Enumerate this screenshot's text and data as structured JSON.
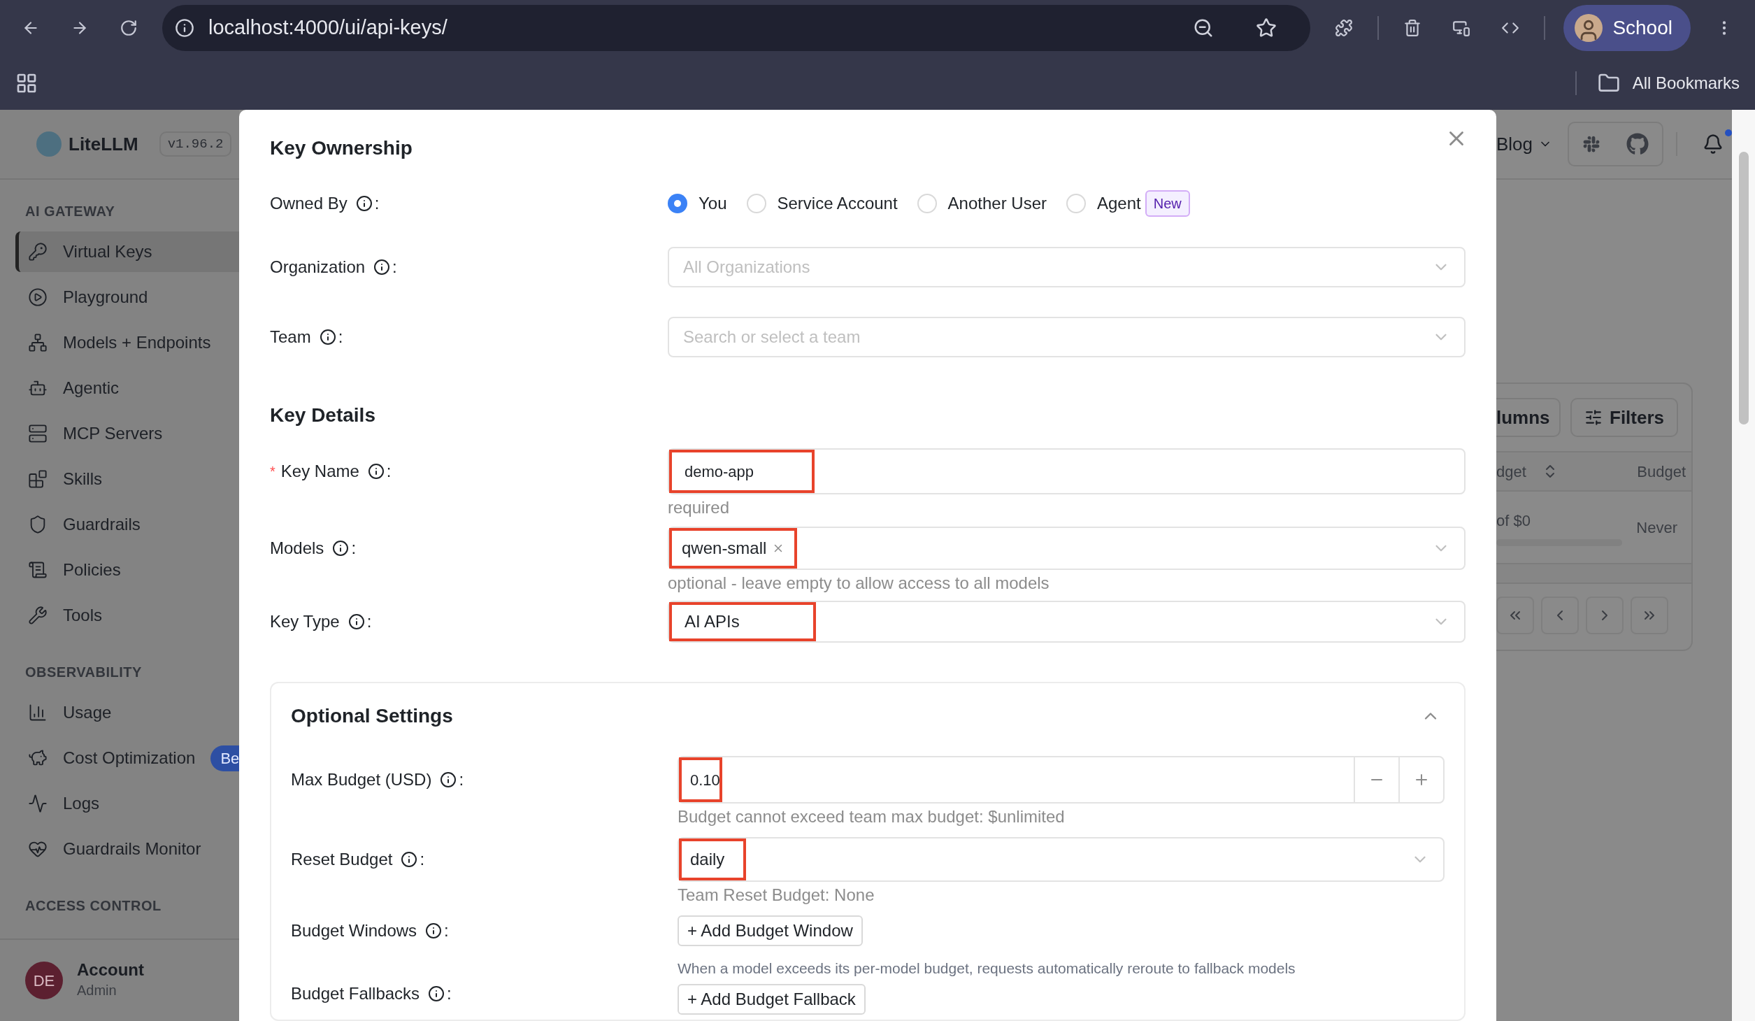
{
  "browser": {
    "url": "localhost:4000/ui/api-keys/",
    "profile": "School",
    "bookmarks": "All Bookmarks"
  },
  "app": {
    "logo": "LiteLLM",
    "version": "v1.96.2",
    "sidebar": [
      {
        "title": "AI GATEWAY",
        "items": [
          {
            "label": "Virtual Keys",
            "selected": true
          },
          {
            "label": "Playground",
            "selected": false
          },
          {
            "label": "Models + Endpoints",
            "selected": false
          },
          {
            "label": "Agentic",
            "selected": false
          },
          {
            "label": "MCP Servers",
            "selected": false
          },
          {
            "label": "Skills",
            "selected": false
          },
          {
            "label": "Guardrails",
            "selected": false
          },
          {
            "label": "Policies",
            "selected": false
          },
          {
            "label": "Tools",
            "selected": false
          }
        ]
      },
      {
        "title": "OBSERVABILITY",
        "items": [
          {
            "label": "Usage",
            "selected": false
          },
          {
            "label": "Cost Optimization",
            "selected": false,
            "badge": "Be"
          },
          {
            "label": "Logs",
            "selected": false
          },
          {
            "label": "Guardrails Monitor",
            "selected": false
          }
        ]
      },
      {
        "title": "ACCESS CONTROL"
      }
    ],
    "account": {
      "initials": "DE",
      "name": "Account",
      "role": "Admin"
    },
    "header": {
      "blog": "Blog",
      "unread": true
    },
    "keys_table": {
      "buttons": [
        "lumns",
        "Filters"
      ],
      "columns": [
        "dget",
        "Budget"
      ],
      "row": [
        "of $0",
        "Never"
      ],
      "budget": {
        "level": 0
      }
    }
  },
  "modal": {
    "ownership": {
      "title": "Key Ownership",
      "owned_by": {
        "label": "Owned By",
        "colon": ":",
        "options": [
          {
            "label": "You",
            "selected": true
          },
          {
            "label": "Service Account",
            "selected": false
          },
          {
            "label": "Another User",
            "selected": false
          },
          {
            "label": "Agent",
            "selected": false,
            "badge": "New"
          }
        ]
      },
      "organization": {
        "label": "Organization",
        "colon": ":",
        "placeholder": "All Organizations"
      },
      "team": {
        "label": "Team",
        "colon": ":",
        "placeholder": "Search or select a team"
      }
    },
    "details": {
      "title": "Key Details",
      "key_name": {
        "label": "Key Name",
        "colon": ":",
        "required": true,
        "required_mark": "*",
        "value": "demo-app",
        "highlighted": true,
        "help": "required"
      },
      "models": {
        "label": "Models",
        "colon": ":",
        "tags": [
          "qwen-small"
        ],
        "highlighted": true,
        "help": "optional - leave empty to allow access to all models"
      },
      "key_type": {
        "label": "Key Type",
        "colon": ":",
        "value": "AI APIs",
        "highlighted": true
      }
    },
    "optional": {
      "title": "Optional Settings",
      "expanded": true,
      "max_budget": {
        "label": "Max Budget (USD)",
        "colon": ":",
        "value": "0.10",
        "highlighted": true,
        "help": "Budget cannot exceed team max budget: $unlimited"
      },
      "reset_budget": {
        "label": "Reset Budget",
        "colon": ":",
        "value": "daily",
        "highlighted": true,
        "help": "Team Reset Budget: None"
      },
      "budget_windows": {
        "label": "Budget Windows",
        "colon": ":",
        "button": "+ Add Budget Window"
      },
      "budget_fallbacks": {
        "label": "Budget Fallbacks",
        "colon": ":",
        "description": "When a model exceeds its per-model budget, requests automatically reroute to fallback models",
        "button": "+ Add Budget Fallback"
      }
    }
  }
}
